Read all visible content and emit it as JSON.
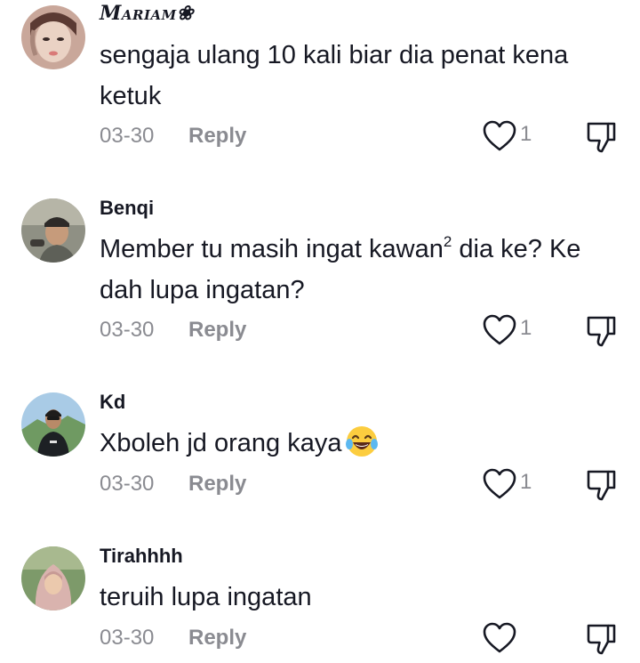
{
  "comments": [
    {
      "username": "Mariam❀",
      "text": "sengaja ulang 10 kali biar dia penat kena ketuk",
      "date": "03-30",
      "reply_label": "Reply",
      "likes": "1",
      "avatar_icon": "avatar-photo"
    },
    {
      "username": "Benqi",
      "text_main": "Member tu masih ingat kawan",
      "text_sup": "2",
      "text_rest": " dia ke? Ke dah lupa ingatan?",
      "date": "03-30",
      "reply_label": "Reply",
      "likes": "1",
      "avatar_icon": "avatar-photo"
    },
    {
      "username": "Kd",
      "text": "Xboleh jd orang kaya",
      "emoji": "face-with-tears-of-joy",
      "date": "03-30",
      "reply_label": "Reply",
      "likes": "1",
      "avatar_icon": "avatar-photo"
    },
    {
      "username": "Tirahhhh",
      "text": "teruih lupa ingatan",
      "date": "03-30",
      "reply_label": "Reply",
      "likes": "",
      "avatar_icon": "avatar-photo"
    }
  ],
  "colors": {
    "text": "#161823",
    "muted": "#8a8b91",
    "background": "#ffffff"
  }
}
